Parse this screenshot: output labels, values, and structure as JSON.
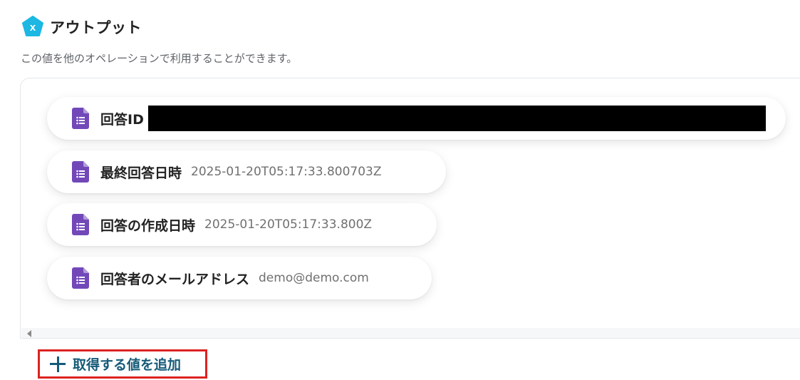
{
  "header": {
    "logo_letter": "x",
    "title": "アウトプット"
  },
  "description": "この値を他のオペレーションで利用することができます。",
  "outputs": [
    {
      "label": "回答ID",
      "value": "",
      "icon": "google-forms-icon",
      "redacted": true
    },
    {
      "label": "最終回答日時",
      "value": "2025-01-20T05:17:33.800703Z",
      "icon": "google-forms-icon"
    },
    {
      "label": "回答の作成日時",
      "value": "2025-01-20T05:17:33.800Z",
      "icon": "google-forms-icon"
    },
    {
      "label": "回答者のメールアドレス",
      "value": "demo@demo.com",
      "icon": "google-forms-icon"
    }
  ],
  "add_button": {
    "label": "取得する値を追加",
    "icon": "plus-icon"
  },
  "colors": {
    "logo": "#1cb7e3",
    "forms_icon": "#7248b9",
    "add_button_text": "#145a78",
    "highlight_border": "#dd2222"
  }
}
